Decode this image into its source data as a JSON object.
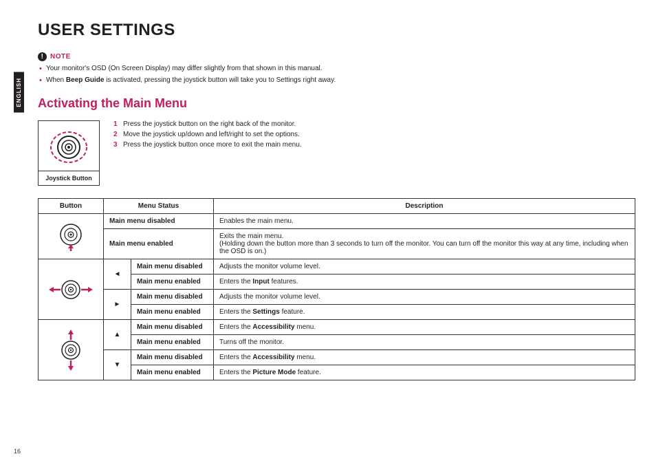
{
  "lang_tab": "ENGLISH",
  "title": "USER SETTINGS",
  "note": {
    "label": "NOTE",
    "items": [
      {
        "pre": "Your monitor's OSD (On Screen Display) may differ slightly from that shown in this manual.",
        "bold": "",
        "post": ""
      },
      {
        "pre": "When ",
        "bold": "Beep Guide",
        "post": " is activated, pressing the joystick button will take you to Settings right away."
      }
    ]
  },
  "section_title": "Activating the Main Menu",
  "joystick_caption": "Joystick Button",
  "steps": [
    "Press the joystick button on the right back of the monitor.",
    "Move the joystick up/down and left/right to set the options.",
    "Press the joystick button once more to exit the main menu."
  ],
  "table": {
    "headers": {
      "button": "Button",
      "menu_status": "Menu Status",
      "description": "Description"
    },
    "rows": [
      {
        "status": "Main menu disabled",
        "desc_pre": "Enables the main menu.",
        "desc_bold": "",
        "desc_post": ""
      },
      {
        "status": "Main menu enabled",
        "desc_pre": "Exits the main menu.\n(Holding down the button more than 3 seconds to turn off the monitor. You can turn off the monitor this way at any time, including when the OSD is on.)",
        "desc_bold": "",
        "desc_post": ""
      },
      {
        "status": "Main menu disabled",
        "desc_pre": "Adjusts the monitor volume level.",
        "desc_bold": "",
        "desc_post": ""
      },
      {
        "status": "Main menu enabled",
        "desc_pre": "Enters the ",
        "desc_bold": "Input",
        "desc_post": " features."
      },
      {
        "status": "Main menu disabled",
        "desc_pre": "Adjusts the monitor volume level.",
        "desc_bold": "",
        "desc_post": ""
      },
      {
        "status": "Main menu enabled",
        "desc_pre": "Enters the ",
        "desc_bold": "Settings",
        "desc_post": " feature."
      },
      {
        "status": "Main menu disabled",
        "desc_pre": "Enters the ",
        "desc_bold": "Accessibility",
        "desc_post": " menu."
      },
      {
        "status": "Main menu enabled",
        "desc_pre": "Turns off the monitor.",
        "desc_bold": "",
        "desc_post": ""
      },
      {
        "status": "Main menu disabled",
        "desc_pre": "Enters the ",
        "desc_bold": "Accessibility",
        "desc_post": " menu."
      },
      {
        "status": "Main menu enabled",
        "desc_pre": "Enters the ",
        "desc_bold": "Picture Mode",
        "desc_post": " feature."
      }
    ]
  },
  "arrows": {
    "left": "◄",
    "right": "►",
    "up": "▲",
    "down": "▼"
  },
  "page_number": "16"
}
